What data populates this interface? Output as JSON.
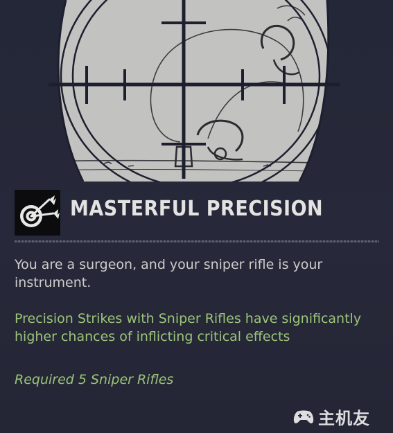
{
  "perk": {
    "title": "MASTERFUL PRECISION",
    "icon": "target-with-arrows-icon",
    "description": "You are a surgeon, and your sniper rifle is your instrument.",
    "effect": "Precision Strikes with Sniper Rifles have significantly higher chances of inflicting critical effects",
    "requirement": "Required 5 Sniper Rifles"
  },
  "watermark": {
    "text": "主机友",
    "icon": "gamepad-icon"
  },
  "colors": {
    "background": "#25283a",
    "title": "#e3e3e1",
    "description": "#cdcdcb",
    "effect": "#9cc47a",
    "scope_fill": "#c2c2c0",
    "crosshair": "#1d1f2e"
  }
}
